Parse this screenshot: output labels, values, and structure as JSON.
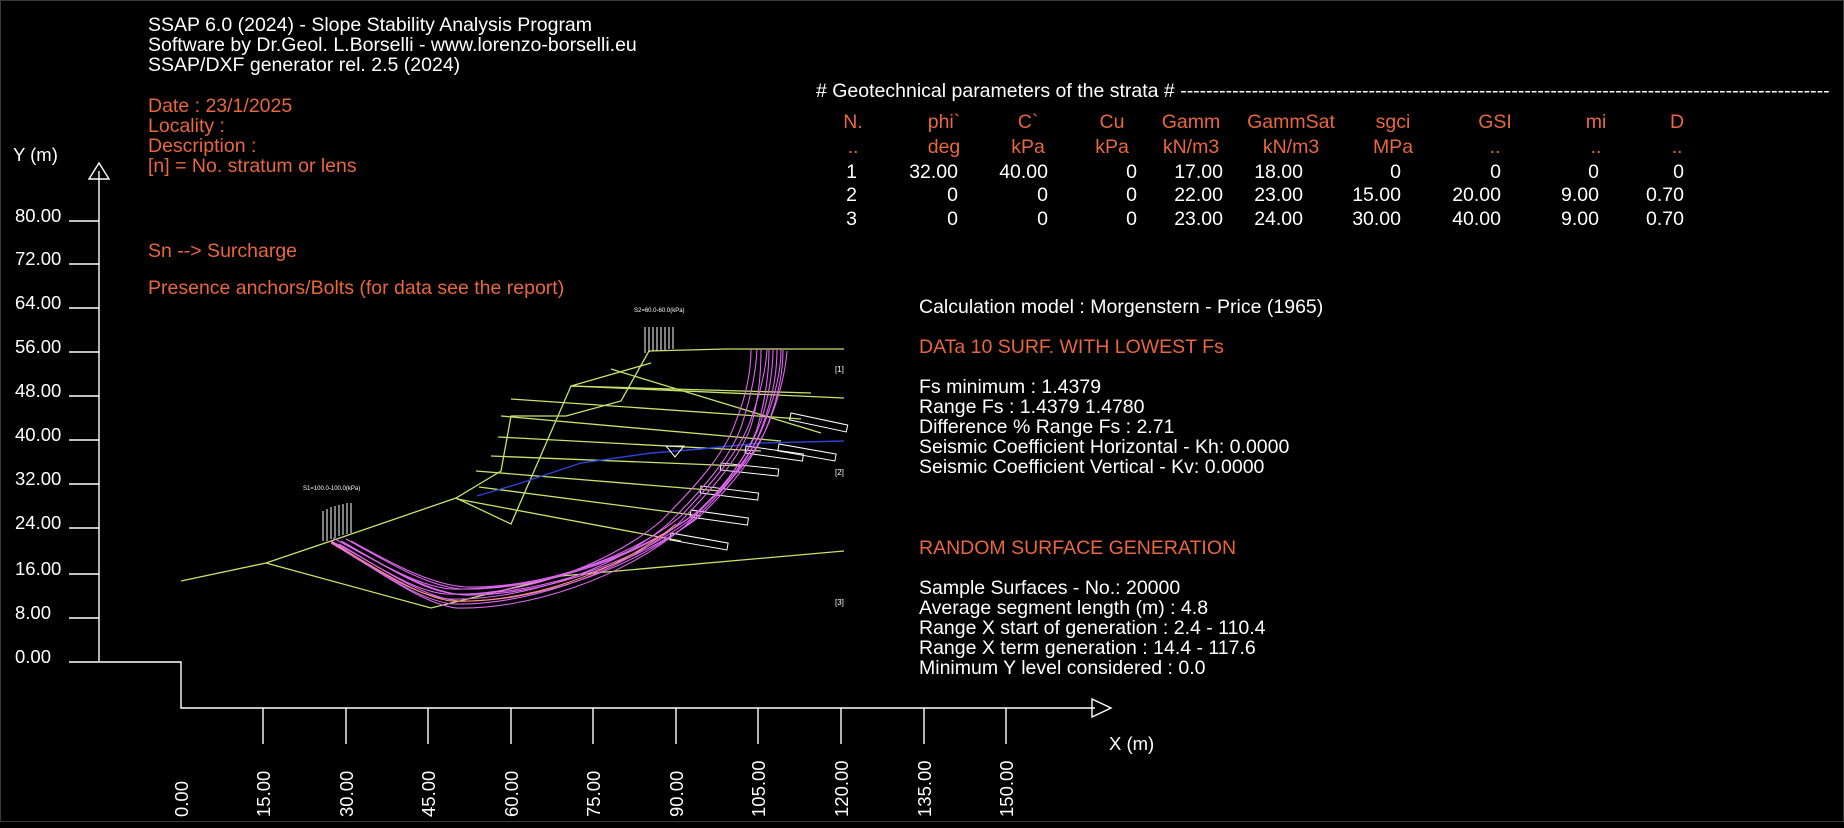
{
  "header": {
    "line1": "SSAP 6.0 (2024) - Slope Stability Analysis Program",
    "line2": "Software by Dr.Geol. L.Borselli - www.lorenzo-borselli.eu",
    "line3": "SSAP/DXF generator rel. 2.5 (2024)"
  },
  "info": {
    "date": "Date : 23/1/2025",
    "locality": "Locality :",
    "description": "Description :",
    "stratum_legend": "[n]  = No. stratum or lens",
    "surcharge_legend": "Sn --> Surcharge",
    "anchors_legend": "Presence anchors/Bolts (for data see the report)"
  },
  "strata_table": {
    "title": "# Geotechnical parameters of the strata # ----------------------------------------------------------------------------------------------------",
    "headers": [
      "N.",
      "phi`",
      "C`",
      "Cu",
      "Gamm",
      "GammSat",
      "sgci",
      "GSI",
      "mi",
      "D"
    ],
    "units": [
      "..",
      "deg",
      "kPa",
      "kPa",
      "kN/m3",
      "kN/m3",
      "MPa",
      "..",
      "..",
      ".."
    ],
    "rows": [
      [
        "1",
        "32.00",
        "40.00",
        "0",
        "17.00",
        "18.00",
        "0",
        "0",
        "0",
        "0"
      ],
      [
        "2",
        "0",
        "0",
        "0",
        "22.00",
        "23.00",
        "15.00",
        "20.00",
        "9.00",
        "0.70"
      ],
      [
        "3",
        "0",
        "0",
        "0",
        "23.00",
        "24.00",
        "30.00",
        "40.00",
        "9.00",
        "0.70"
      ]
    ]
  },
  "results": {
    "model": "Calculation model : Morgenstern - Price (1965)",
    "lowest_title": "DATa 10 SURF. WITH LOWEST Fs",
    "fs_min": "Fs minimum : 1.4379",
    "range_fs": "Range Fs :  1.4379   1.4780",
    "diff_range": "Difference % Range Fs : 2.71",
    "kh": "Seismic Coefficient Horizontal   - Kh:   0.0000",
    "kv": "Seismic Coefficient Vertical     - Kv:   0.0000"
  },
  "generation": {
    "title": "RANDOM SURFACE GENERATION",
    "samples": "Sample Surfaces - No.:          20000",
    "avg_seg": "Average segment length (m) :   4.8",
    "range_x_start": "Range X start of generation :  2.4 - 110.4",
    "range_x_term": "Range X term generation :      14.4 - 117.6",
    "min_y": "Minimum Y level considered :   0.0"
  },
  "plot": {
    "y_axis_label": "Y (m)",
    "x_axis_label": "X (m)",
    "y_ticks": [
      "80.00",
      "72.00",
      "64.00",
      "56.00",
      "48.00",
      "40.00",
      "32.00",
      "24.00",
      "16.00",
      "8.00",
      "0.00"
    ],
    "x_ticks": [
      "0.00",
      "15.00",
      "30.00",
      "45.00",
      "60.00",
      "75.00",
      "90.00",
      "105.00",
      "120.00",
      "135.00",
      "150.00"
    ],
    "strata_labels": [
      "[1]",
      "[2]",
      "[3]"
    ],
    "surcharge_1": "S1=100.0-100.0(kPa)",
    "surcharge_2": "S2=60.0-60.0(kPa)",
    "colors": {
      "text": "#ffffff",
      "accent": "#e8673d",
      "strata_lines": "#c6e36b",
      "slip_surfaces": "#dd66ee",
      "water_table": "#2a43d9"
    }
  }
}
